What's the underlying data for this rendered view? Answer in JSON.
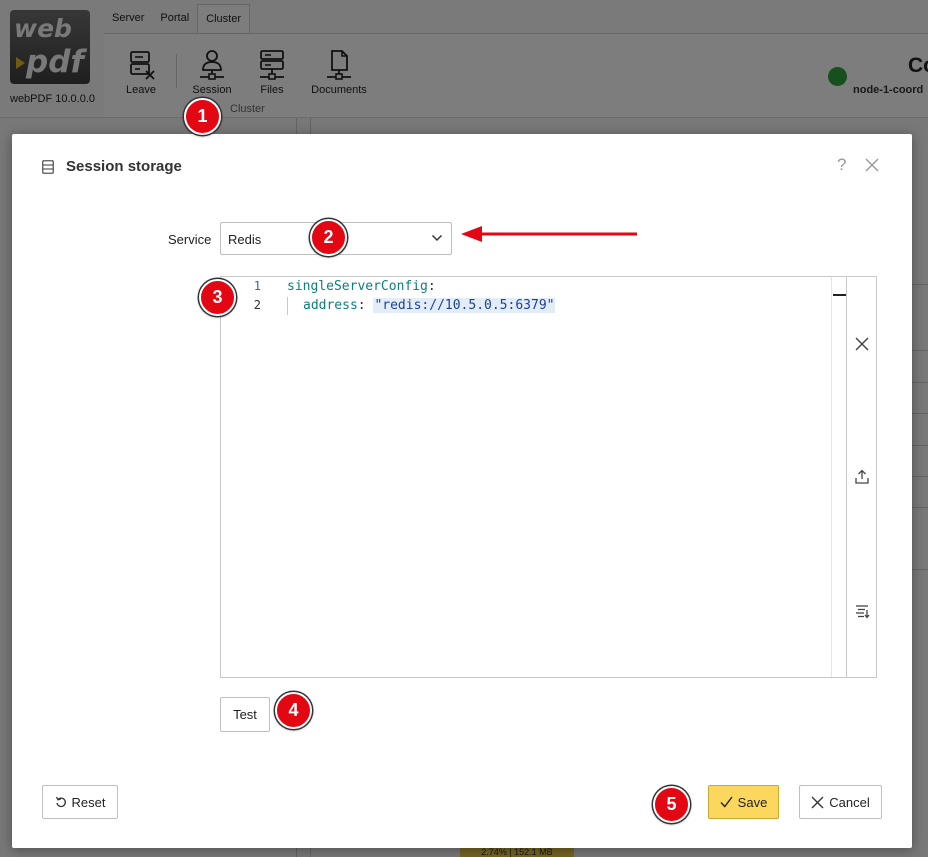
{
  "app": {
    "logo_line1": "web",
    "logo_line2": "pdf",
    "version": "webPDF 10.0.0.0",
    "tabs": [
      {
        "label": "Server"
      },
      {
        "label": "Portal"
      },
      {
        "label": "Cluster",
        "active": true
      }
    ],
    "ribbon": {
      "buttons": [
        {
          "label": "Leave",
          "icon": "server-remove-icon"
        },
        {
          "label": "Session",
          "icon": "user-network-icon"
        },
        {
          "label": "Files",
          "icon": "server-network-icon"
        },
        {
          "label": "Documents",
          "icon": "document-network-icon"
        }
      ],
      "group_label": "Cluster"
    },
    "node": {
      "title": "Co",
      "name": "node-1-coord",
      "status_color": "#2e9e3a"
    },
    "bottom_badge": "2.74% | 152.1 MB"
  },
  "dialog": {
    "title": "Session storage",
    "help": "?",
    "service_label": "Service",
    "service_value": "Redis",
    "editor": {
      "line_numbers": [
        "1",
        "2"
      ],
      "lines": [
        {
          "key": "singleServerConfig",
          "punct": ":"
        },
        {
          "key": "address",
          "punct": ":",
          "value": "\"redis://10.5.0.5:6379\""
        }
      ]
    },
    "test_label": "Test",
    "reset_label": "Reset",
    "save_label": "Save",
    "cancel_label": "Cancel",
    "save_color": "#fbd85d"
  },
  "annotations": [
    {
      "number": "1"
    },
    {
      "number": "2"
    },
    {
      "number": "3"
    },
    {
      "number": "4"
    },
    {
      "number": "5"
    }
  ],
  "annotation_color": "#e30613"
}
